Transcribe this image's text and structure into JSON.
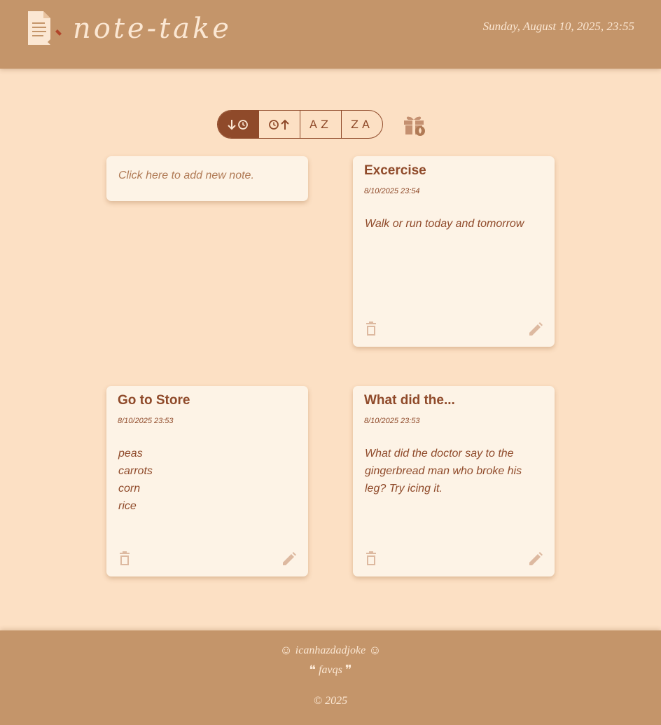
{
  "header": {
    "title": "note-take",
    "datetime": "Sunday, August 10, 2025, 23:55",
    "logo_icon": "note-document-pencil-icon"
  },
  "sort": {
    "options": [
      {
        "label": "",
        "icon": "newest-first-icon",
        "active": true
      },
      {
        "label": "",
        "icon": "oldest-first-icon",
        "active": false
      },
      {
        "label": "AZ",
        "icon": "",
        "active": false
      },
      {
        "label": "ZA",
        "icon": "",
        "active": false
      }
    ],
    "extra_icon": "gift-icon"
  },
  "add_note": {
    "placeholder": "Click here to add new note."
  },
  "notes": [
    {
      "title": "Excercise",
      "date": "8/10/2025 23:54",
      "body": [
        "Walk or run today and tomorrow"
      ]
    },
    {
      "title": "Go to Store",
      "date": "8/10/2025 23:53",
      "body": [
        "peas",
        "carrots",
        "corn",
        "rice"
      ]
    },
    {
      "title": "What did the...",
      "date": "8/10/2025 23:53",
      "body": [
        "What did the doctor say to the gingerbread man who broke his leg? Try icing it."
      ]
    }
  ],
  "footer": {
    "joke_link": "icanhazdadjoke",
    "quote_link": "favqs",
    "copyright": "© 2025"
  },
  "colors": {
    "header_bg": "#c4956a",
    "page_bg": "#fce0c4",
    "card_bg": "#fdf3e6",
    "accent": "#8f4a2a",
    "light_text": "#fbe7d3"
  }
}
